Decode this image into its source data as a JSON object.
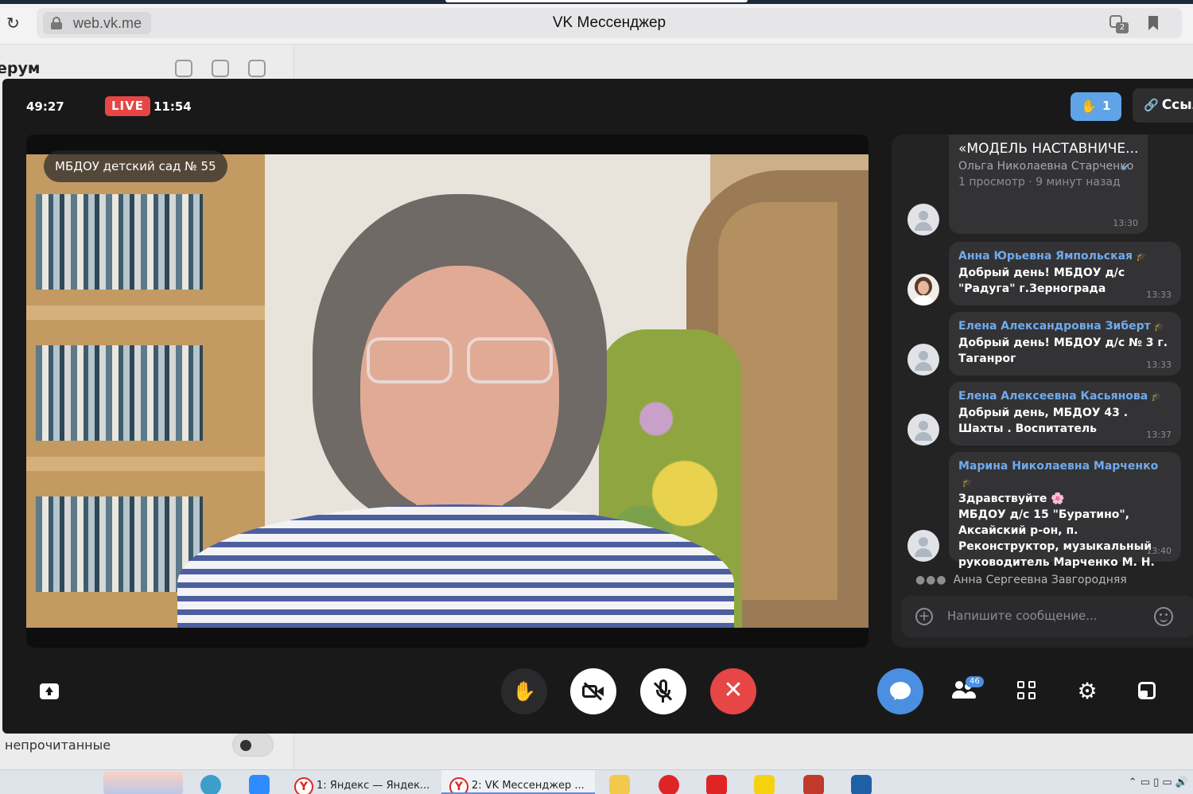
{
  "browser": {
    "url": "web.vk.me",
    "title": "VK Мессенджер",
    "tab_count": "2"
  },
  "background": {
    "section_title": "ерум",
    "unread_label": "непрочитанные"
  },
  "call": {
    "duration": "49:27",
    "live_label": "LIVE",
    "live_time": "11:54",
    "raised_hands": "1",
    "link_label": "Ссылка",
    "speaker_name": "МБДОУ детский сад № 55"
  },
  "chat": {
    "post": {
      "title": "«МОДЕЛЬ НАСТАВНИЧЕ...",
      "author": "Ольга Николаевна Старченко",
      "meta": "1 просмотр · 9 минут назад",
      "time": "13:30"
    },
    "messages": [
      {
        "author": "Анна Юрьевна Ямпольская",
        "text": "Добрый день! МБДОУ д/с \"Радуга\" г.Зернограда",
        "time": "13:33"
      },
      {
        "author": "Елена Александровна Зиберт",
        "text": "Добрый день! МБДОУ  д/с № 3 г. Таганрог",
        "time": "13:33"
      },
      {
        "author": "Елена Алексеевна Касьянова",
        "text": "Добрый день, МБДОУ 43 . Шахты . Воспитатель",
        "time": "13:37"
      },
      {
        "author": "Марина Николаевна Марченко",
        "text": "Здравствуйте 🌸\nМБДОУ д/с 15 \"Буратино\", Аксайский р-он, п. Реконструктор, музыкальный руководитель Марченко М. Н.",
        "time": "13:40"
      }
    ],
    "typing_user": "Анна Сергеевна Завгородняя",
    "input_placeholder": "Напишите сообщение..."
  },
  "controls": {
    "participants_count": "46"
  },
  "taskbar": {
    "items": [
      {
        "label": "1: Яндекс — Яндек..."
      },
      {
        "label": "2: VK Мессенджер ..."
      }
    ]
  },
  "colors": {
    "accent": "#4a8fe0",
    "live": "#e64646",
    "author": "#71aaeb",
    "call_bg": "#19191a"
  }
}
